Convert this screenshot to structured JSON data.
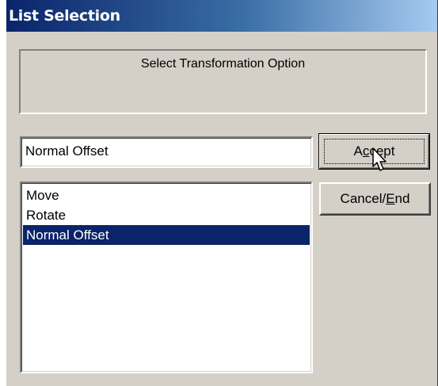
{
  "window": {
    "title": "List Selection"
  },
  "prompt": {
    "text": "Select Transformation Option"
  },
  "selection_field": {
    "value": "Normal Offset"
  },
  "list": {
    "items": [
      {
        "label": "Move",
        "selected": false
      },
      {
        "label": "Rotate",
        "selected": false
      },
      {
        "label": "Normal Offset",
        "selected": true
      }
    ]
  },
  "buttons": {
    "accept": {
      "pre": "A",
      "accel": "c",
      "post": "cept",
      "label": "Accept"
    },
    "cancel": {
      "pre": "Cancel/",
      "accel": "E",
      "post": "nd",
      "label": "Cancel/End"
    }
  },
  "colors": {
    "title_bar": "#0a246a",
    "dialog_face": "#d4d0c8",
    "selection_highlight": "#0a246a"
  },
  "icons": {
    "cursor": "mouse-pointer-icon"
  }
}
